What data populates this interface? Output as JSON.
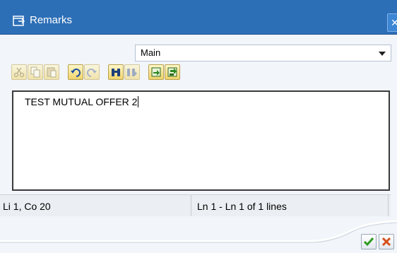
{
  "window": {
    "title": "Remarks",
    "close_label": "✕",
    "colors": {
      "titlebar": "#2d6fb7",
      "body": "#f2f5f9"
    }
  },
  "dropdown": {
    "selected": "Main"
  },
  "toolbar": {
    "buttons": [
      {
        "name": "cut-icon",
        "enabled": false
      },
      {
        "name": "copy-icon",
        "enabled": false
      },
      {
        "name": "paste-icon",
        "enabled": false
      },
      {
        "name": "undo-icon",
        "enabled": true
      },
      {
        "name": "redo-icon",
        "enabled": false
      },
      {
        "name": "find-icon",
        "enabled": true
      },
      {
        "name": "find-next-icon",
        "enabled": false
      },
      {
        "name": "load-local-file-icon",
        "enabled": true
      },
      {
        "name": "save-local-file-icon",
        "enabled": true
      }
    ]
  },
  "editor": {
    "text": "TEST MUTUAL OFFER 2"
  },
  "status": {
    "cursor_position": "Li 1, Co 20",
    "line_range": "Ln 1 - Ln 1 of 1 lines"
  },
  "actions": {
    "ok_icon": "checkmark-icon",
    "cancel_icon": "cancel-x-icon"
  }
}
